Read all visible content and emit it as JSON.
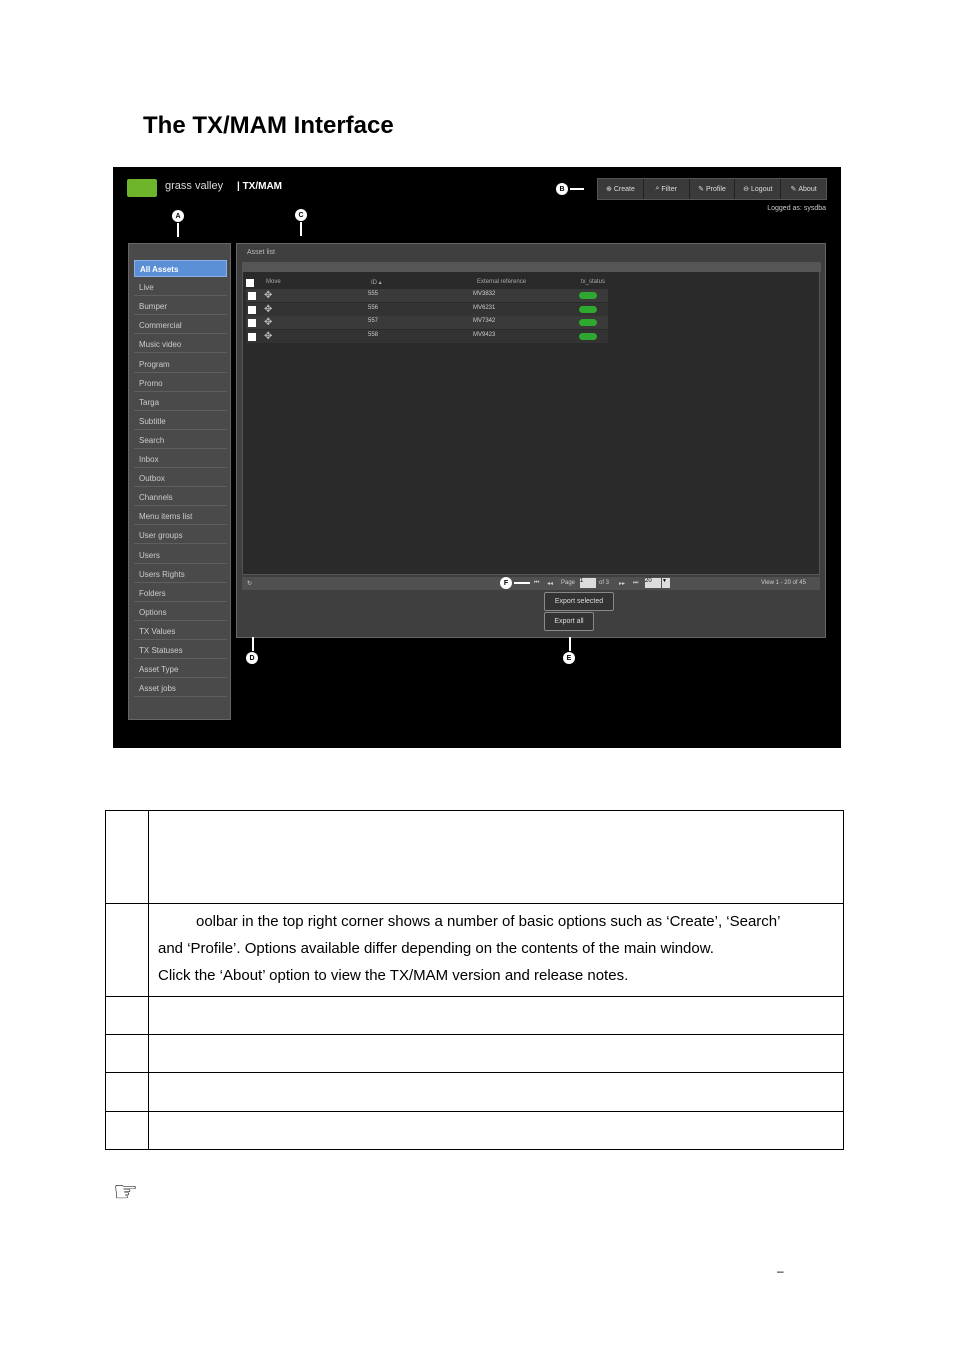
{
  "doc_title": "The TX/MAM Interface",
  "app": {
    "logo_text": "grass valley",
    "product": "| TX/MAM",
    "logged_in": "Logged as: sysdba",
    "toolbar": [
      {
        "icon": "plus-circle-icon",
        "glyph": "⊕",
        "label": "Create"
      },
      {
        "icon": "search-icon",
        "glyph": "⌕",
        "label": "Filter"
      },
      {
        "icon": "wrench-icon",
        "glyph": "✎",
        "label": "Profile"
      },
      {
        "icon": "logout-icon",
        "glyph": "⊖",
        "label": "Logout"
      },
      {
        "icon": "wrench-icon",
        "glyph": "✎",
        "label": "About"
      }
    ],
    "callouts": {
      "a": "A",
      "b": "B",
      "c": "C",
      "d": "D",
      "e": "E",
      "f": "F"
    },
    "sidebar": [
      "All Assets",
      "Live",
      "Bumper",
      "Commercial",
      "Music video",
      "Program",
      "Promo",
      "Targa",
      "Subtitle",
      "Search",
      "Inbox",
      "Outbox",
      "Channels",
      "Menu items list",
      "User groups",
      "Users",
      "Users Rights",
      "Folders",
      "Options",
      "TX Values",
      "TX Statuses",
      "Asset Type",
      "Asset jobs"
    ],
    "panel_title": "Asset list",
    "columns": {
      "move": "Move",
      "id": "ID ▴",
      "ext": "External reference",
      "status": "tx_status"
    },
    "rows": [
      {
        "id": "555",
        "ext": "MV3832"
      },
      {
        "id": "556",
        "ext": "MV6231"
      },
      {
        "id": "557",
        "ext": "MV7342"
      },
      {
        "id": "558",
        "ext": "MV9423"
      }
    ],
    "pager": {
      "page_label": "Page",
      "page": "1",
      "of": "of 3",
      "size": "20",
      "view": "View 1 - 20 of 45",
      "first": "⏮",
      "prev": "◂◂",
      "next": "▸▸",
      "last": "⏭",
      "refresh": "↻"
    },
    "export_selected": "Export selected",
    "export_all": "Export all"
  },
  "legend": {
    "row2_line1": "oolbar in the top right corner shows a number of basic options such as ‘Create’, ‘Search’",
    "row2_line2": "and ‘Profile’. Options available differ depending on the contents of the main window.",
    "row2_line3": "Click the ‘About’ option to view the TX/MAM version and release notes."
  },
  "note_icon": "☞",
  "footer_mark": "–"
}
